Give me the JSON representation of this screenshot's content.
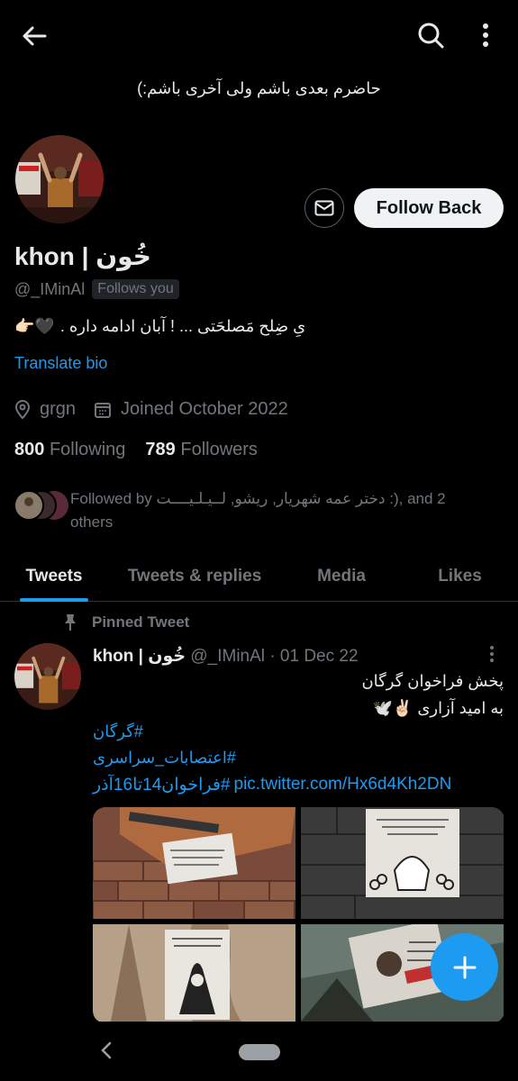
{
  "header": {
    "banner_text": "حاضرم بعدی باشم ولی آخری باشم:)"
  },
  "profile": {
    "follow_button_label": "Follow Back",
    "display_name": "khon | خُون",
    "handle": "@_IMinAl",
    "follows_you_badge": "Follows you",
    "bio_text": "یِ ضِلح مَصلحَتی ... ! آبان ادامه داره .",
    "bio_emojis": "👉🏻🖤",
    "translate_bio": "Translate bio",
    "location": "grgn",
    "joined": "Joined October 2022",
    "following_count": "800",
    "following_label": "Following",
    "followers_count": "789",
    "followers_label": "Followers",
    "followed_by_text": "Followed by ‏دختر عمه شهریار‏, ریشو, لــیـلـیــــت :), and 2 others"
  },
  "tabs": [
    {
      "label": "Tweets",
      "active": true
    },
    {
      "label": "Tweets & replies",
      "active": false
    },
    {
      "label": "Media",
      "active": false
    },
    {
      "label": "Likes",
      "active": false
    }
  ],
  "tweet": {
    "pinned_label": "Pinned Tweet",
    "author_name": "khon | خُون",
    "author_handle": "@_IMinAl",
    "separator": "·",
    "date": "01 Dec 22",
    "line1": "پخش فراخوان گرگان",
    "line2": "به امید آزاری ✌🏻🕊️",
    "hashtag1": "#گرگان",
    "hashtag2": "#اعتصابات_سراسری",
    "hashtag3": "#فراخوان14تا16آذر",
    "link": "pic.twitter.com/Hx6d4Kh2DN"
  },
  "colors": {
    "background": "#000000",
    "accent": "#1d9bf0",
    "text": "#e7e9ea",
    "muted": "#71767b"
  },
  "icons": {
    "back": "back-arrow-icon",
    "search": "search-icon",
    "more": "more-vertical-icon",
    "mail": "mail-icon",
    "location": "location-pin-icon",
    "calendar": "calendar-icon",
    "pin": "pin-icon",
    "compose": "plus-icon"
  }
}
